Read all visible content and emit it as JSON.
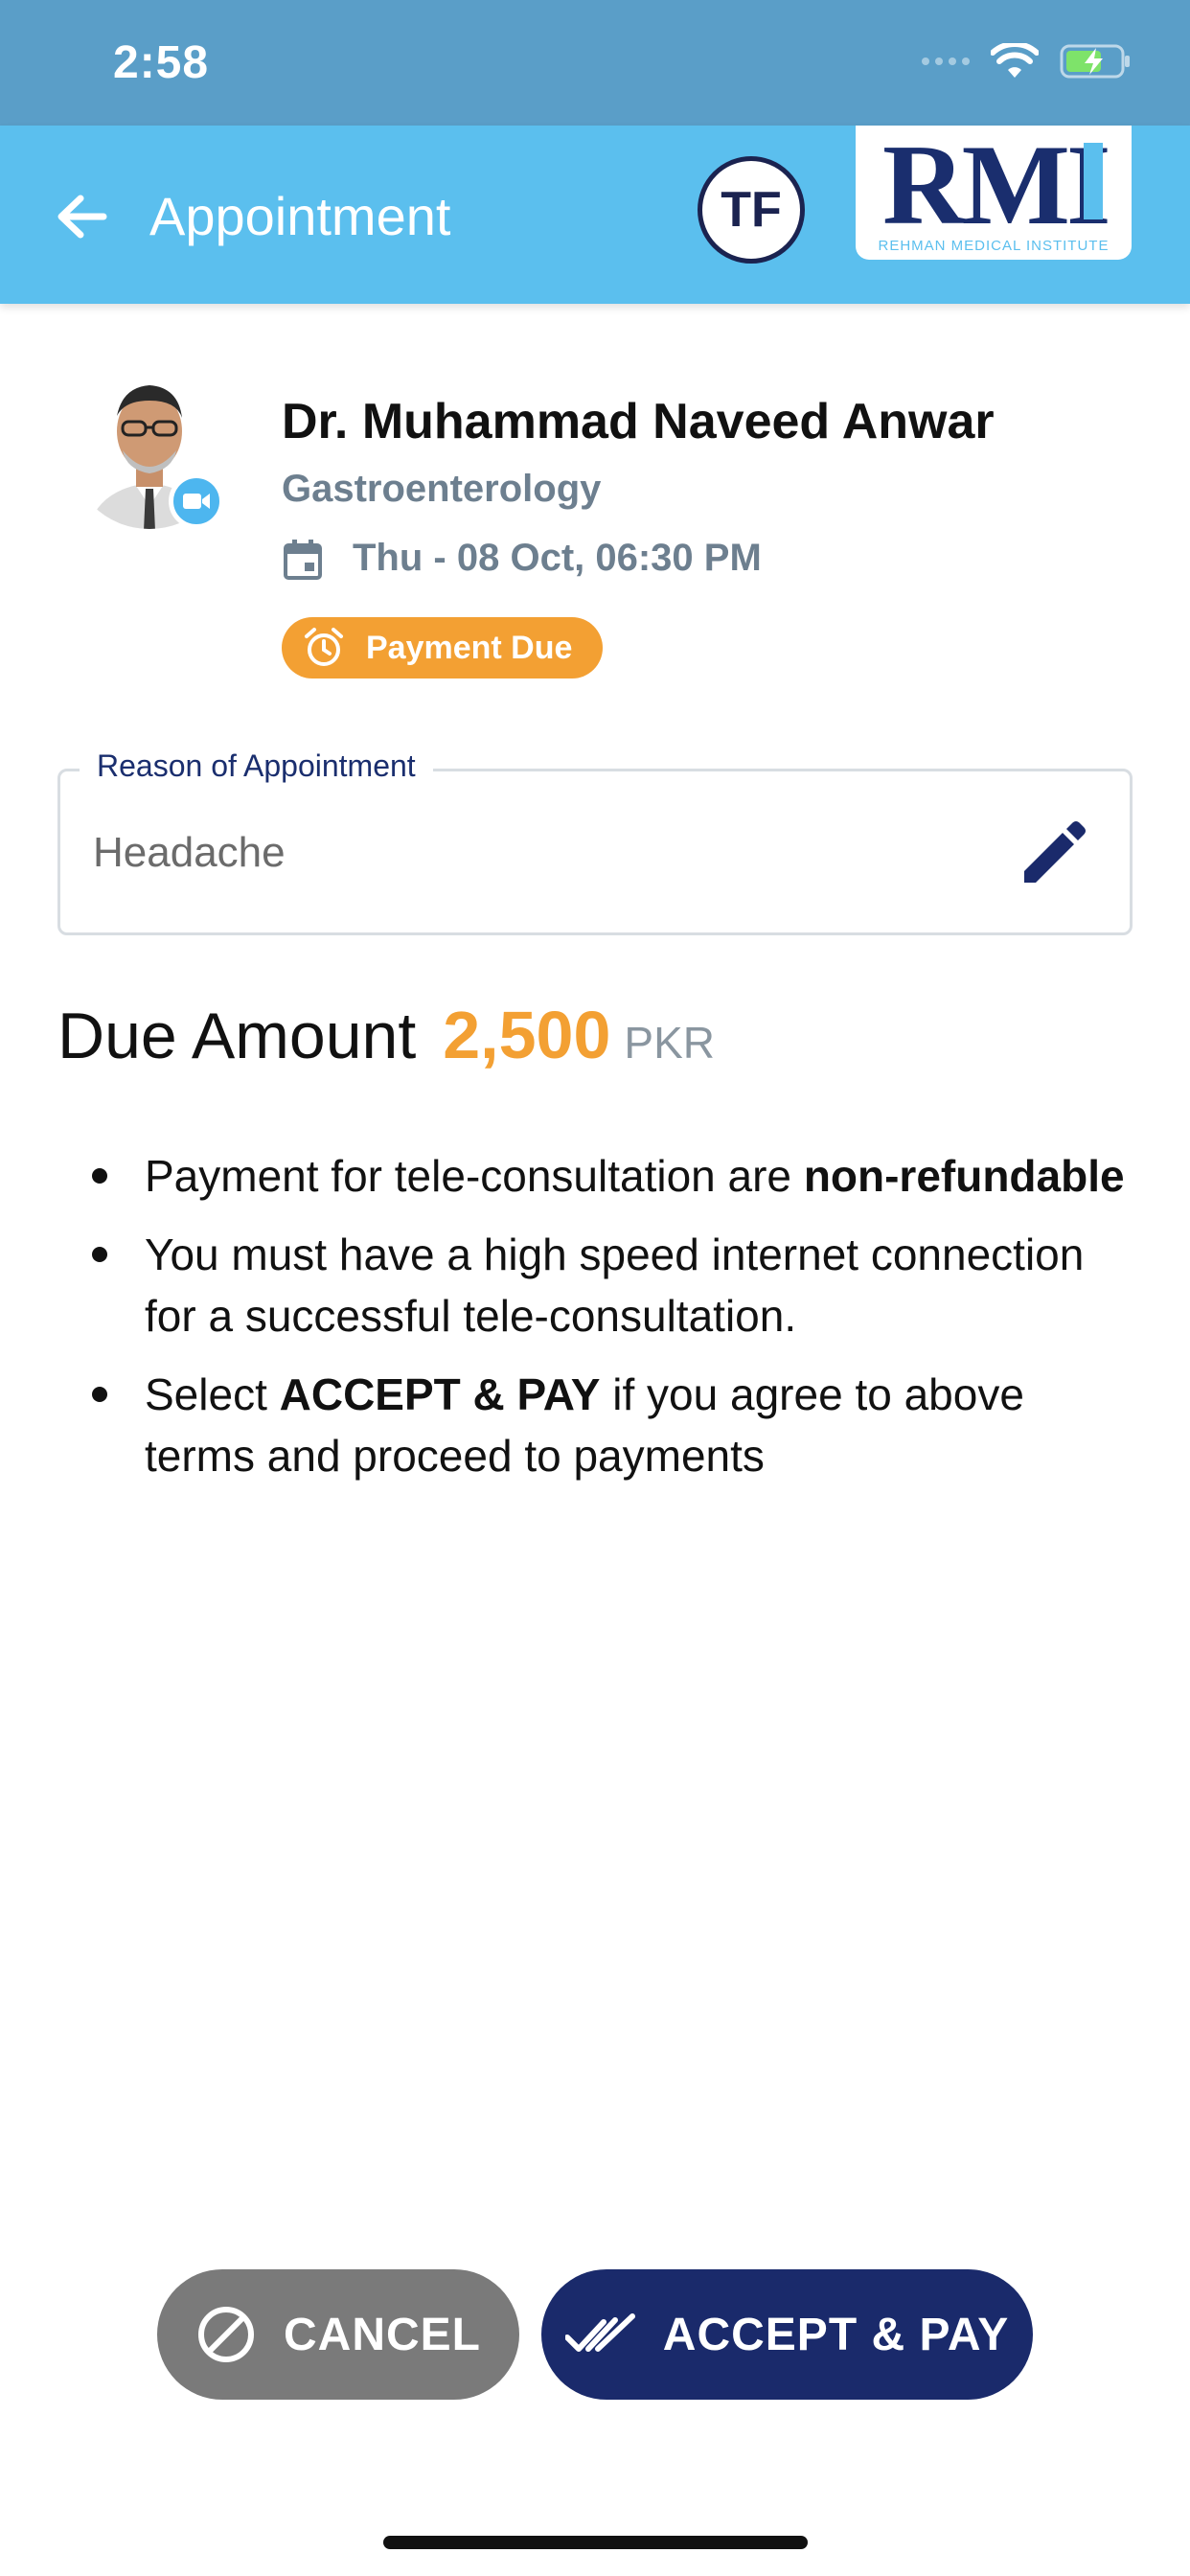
{
  "status_bar": {
    "time": "2:58"
  },
  "app_bar": {
    "title": "Appointment",
    "user_initials": "TF",
    "logo": {
      "letters": "RMI",
      "subtitle": "REHMAN MEDICAL INSTITUTE"
    }
  },
  "doctor": {
    "name": "Dr. Muhammad Naveed Anwar",
    "specialty": "Gastroenterology",
    "datetime": "Thu - 08 Oct, 06:30 PM",
    "status": "Payment Due"
  },
  "reason": {
    "label": "Reason of Appointment",
    "value": "Headache"
  },
  "due": {
    "label": "Due Amount",
    "amount": "2,500",
    "currency": "PKR"
  },
  "terms": [
    {
      "text": "Payment for tele-consultation are ",
      "bold": "non-refundable",
      "after": ""
    },
    {
      "text": "You must have a high speed internet connection for a successful tele-consultation.",
      "bold": "",
      "after": ""
    },
    {
      "text": "Select ",
      "bold": "ACCEPT & PAY",
      "after": " if you agree to above terms and proceed to payments"
    }
  ],
  "actions": {
    "cancel": "CANCEL",
    "accept": "ACCEPT & PAY"
  },
  "colors": {
    "status_bar": "#5a9ec8",
    "app_bar": "#5bbfee",
    "accent_orange": "#f3a033",
    "navy": "#1a2a6b",
    "cancel_gray": "#7a7a7a"
  },
  "icons": [
    "back-arrow-icon",
    "video-icon",
    "calendar-icon",
    "alarm-clock-icon",
    "edit-pencil-icon",
    "block-icon",
    "double-check-icon",
    "wifi-icon",
    "battery-charging-icon"
  ]
}
